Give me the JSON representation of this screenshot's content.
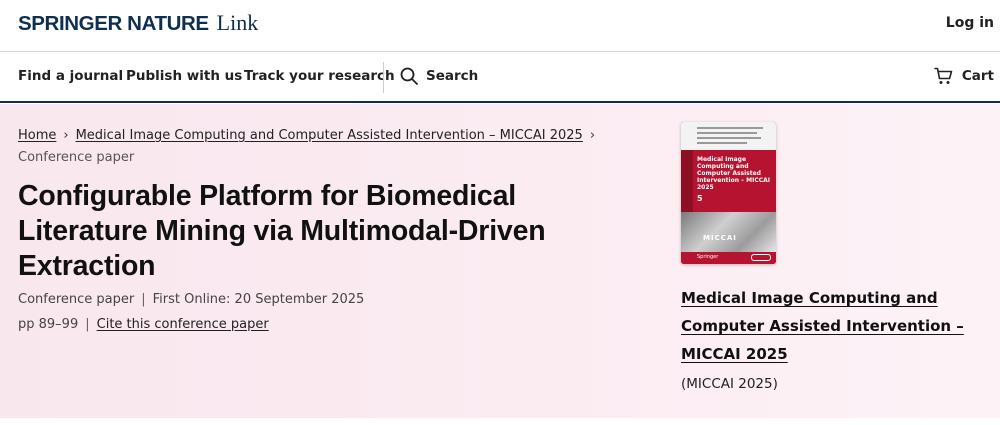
{
  "header": {
    "brand_main": "SPRINGER NATURE",
    "brand_link": "Link",
    "login_label": "Log in"
  },
  "nav": {
    "find_journal": "Find a journal",
    "publish": "Publish with us",
    "track": "Track your research",
    "search_label": "Search",
    "cart_label": "Cart"
  },
  "breadcrumb": {
    "home": "Home",
    "conference": "Medical Image Computing and Computer Assisted Intervention – MICCAI 2025",
    "current": "Conference paper"
  },
  "article": {
    "title": "Configurable Platform for Biomedical Literature Mining via Multimodal-Driven Extraction",
    "type": "Conference paper",
    "first_online": "First Online: 20 September 2025",
    "pages": "pp 89–99",
    "cite_label": "Cite this conference paper"
  },
  "book": {
    "title": "Medical Image Computing and Computer Assisted Intervention – MICCAI 2025",
    "acronym": "(MICCAI 2025)",
    "cover_title": "Medical Image Computing and Computer Assisted Intervention – MICCAI 2025",
    "cover_volume": "5",
    "cover_series": "MICCAI",
    "cover_publisher": "Springer"
  },
  "colors": {
    "brand": "#0e2f4f",
    "hero_background": "#fbecf2",
    "cover_red": "#b5132f"
  },
  "icons": {
    "search": "magnifier-icon",
    "cart": "shopping-cart-icon",
    "breadcrumb_separator": "chevron-right-icon"
  }
}
